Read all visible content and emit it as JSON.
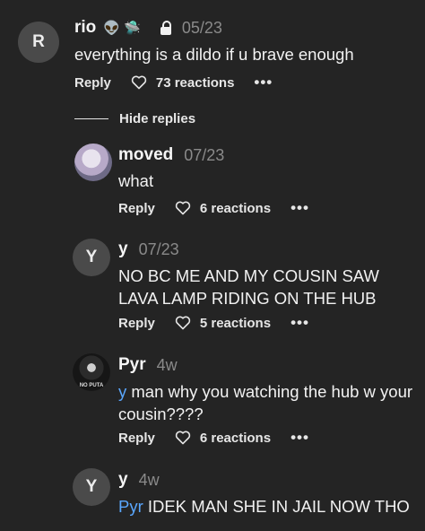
{
  "comments": [
    {
      "initial": "R",
      "username": "rio",
      "emojis": "👽 🛸",
      "time": "05/23",
      "text": "everything is a dildo if u brave enough",
      "reply_label": "Reply",
      "reactions": "73 reactions",
      "more": "•••"
    },
    {
      "username": "moved",
      "time": "07/23",
      "text": "what",
      "reply_label": "Reply",
      "reactions": "6 reactions",
      "more": "•••"
    },
    {
      "initial": "Y",
      "username": "y",
      "time": "07/23",
      "text": "NO BC ME AND MY COUSIN SAW LAVA LAMP RIDING ON THE HUB",
      "reply_label": "Reply",
      "reactions": "5 reactions",
      "more": "•••"
    },
    {
      "username": "Pyr",
      "avatar_caption": "NO PUTA",
      "time": "4w",
      "mention": "y",
      "text": " man why you watching the hub w your cousin????",
      "reply_label": "Reply",
      "reactions": "6 reactions",
      "more": "•••"
    },
    {
      "initial": "Y",
      "username": "y",
      "time": "4w",
      "mention": "Pyr",
      "text": " IDEK MAN SHE IN JAIL NOW THO"
    }
  ],
  "hide_replies_label": "Hide replies",
  "colors": {
    "background": "#242424",
    "mention": "#5aa7ff",
    "muted": "#8a8a8a"
  }
}
